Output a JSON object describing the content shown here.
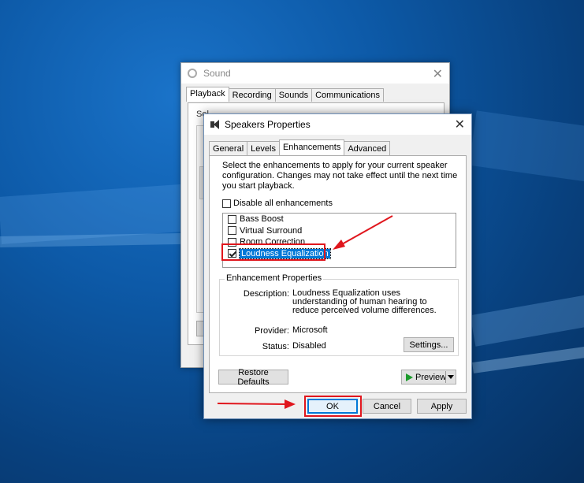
{
  "sound_window": {
    "title": "Sound",
    "tabs": [
      "Playback",
      "Recording",
      "Sounds",
      "Communications"
    ],
    "partial_text": "Sel"
  },
  "props_window": {
    "title": "Speakers Properties",
    "tabs": [
      "General",
      "Levels",
      "Enhancements",
      "Advanced"
    ],
    "active_tab": "Enhancements",
    "intro": "Select the enhancements to apply for your current speaker configuration. Changes may not take effect until the next time you start playback.",
    "disable_all": {
      "label": "Disable all enhancements",
      "checked": false
    },
    "enhancements": [
      {
        "label": "Bass Boost",
        "checked": false,
        "selected": false
      },
      {
        "label": "Virtual Surround",
        "checked": false,
        "selected": false
      },
      {
        "label": "Room Correction",
        "checked": false,
        "selected": false
      },
      {
        "label": "Loudness Equalization",
        "checked": true,
        "selected": true
      }
    ],
    "properties": {
      "legend": "Enhancement Properties",
      "description_label": "Description:",
      "description_value": "Loudness Equalization uses understanding of human hearing to reduce perceived volume differences.",
      "provider_label": "Provider:",
      "provider_value": "Microsoft",
      "status_label": "Status:",
      "status_value": "Disabled",
      "settings_button": "Settings..."
    },
    "restore_button": "Restore Defaults",
    "preview_button": "Preview",
    "ok_button": "OK",
    "cancel_button": "Cancel",
    "apply_button": "Apply"
  },
  "colors": {
    "annotation_red": "#e0161d",
    "selection_blue": "#0078d7",
    "desktop_blue": "#0d5aa8"
  }
}
